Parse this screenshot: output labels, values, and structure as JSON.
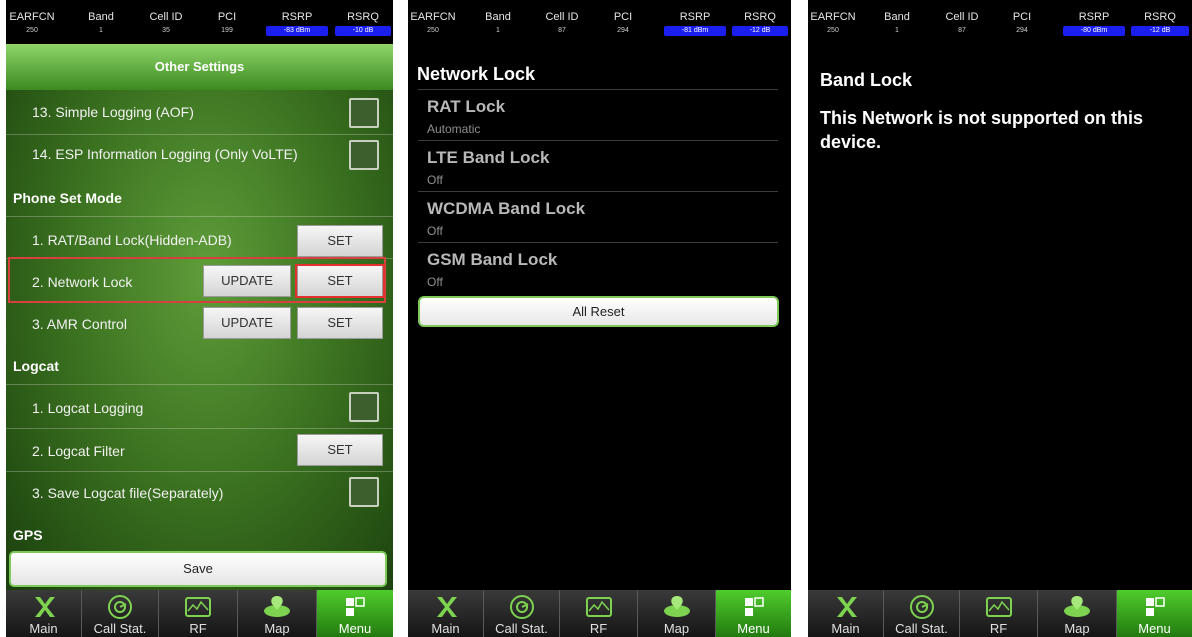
{
  "status_headers": [
    "EARFCN",
    "Band",
    "Cell ID",
    "PCI",
    "RSRP",
    "RSRQ"
  ],
  "screens": [
    {
      "earfcn": "250",
      "band": "1",
      "cell_id": "35",
      "pci": "199",
      "rsrp": "-83 dBm",
      "rsrq": "-10 dB"
    },
    {
      "earfcn": "250",
      "band": "1",
      "cell_id": "87",
      "pci": "294",
      "rsrp": "-81 dBm",
      "rsrq": "-12 dB"
    },
    {
      "earfcn": "250",
      "band": "1",
      "cell_id": "87",
      "pci": "294",
      "rsrp": "-80 dBm",
      "rsrq": "-12 dB"
    }
  ],
  "nav_tabs": [
    {
      "label": "Main",
      "icon": "x-icon"
    },
    {
      "label": "Call Stat.",
      "icon": "call-stat-icon"
    },
    {
      "label": "RF",
      "icon": "rf-icon"
    },
    {
      "label": "Map",
      "icon": "map-icon"
    },
    {
      "label": "Menu",
      "icon": "menu-icon",
      "active": true
    }
  ],
  "other_settings": {
    "title": "Other Settings",
    "logging_items": [
      "13. Simple Logging (AOF)",
      "14. ESP Information Logging (Only VoLTE)"
    ],
    "phone_set_mode": {
      "heading": "Phone Set Mode",
      "items": [
        "1. RAT/Band Lock(Hidden-ADB)",
        "2. Network Lock",
        "3. AMR Control"
      ]
    },
    "logcat": {
      "heading": "Logcat",
      "items": [
        "1. Logcat Logging",
        "2. Logcat Filter",
        "3. Save Logcat file(Separately)"
      ]
    },
    "gps_heading": "GPS",
    "set_label": "SET",
    "update_label": "UPDATE",
    "save_label": "Save",
    "accent_color": "#4fcc2c",
    "highlight_color": "#e53030"
  },
  "network_lock": {
    "title": "Network Lock",
    "items": [
      {
        "title": "RAT Lock",
        "value": "Automatic"
      },
      {
        "title": "LTE Band Lock",
        "value": "Off"
      },
      {
        "title": "WCDMA Band Lock",
        "value": "Off"
      },
      {
        "title": "GSM Band Lock",
        "value": "Off"
      }
    ],
    "reset_label": "All Reset"
  },
  "band_lock": {
    "title": "Band Lock",
    "message": "This Network is not supported on this device."
  }
}
